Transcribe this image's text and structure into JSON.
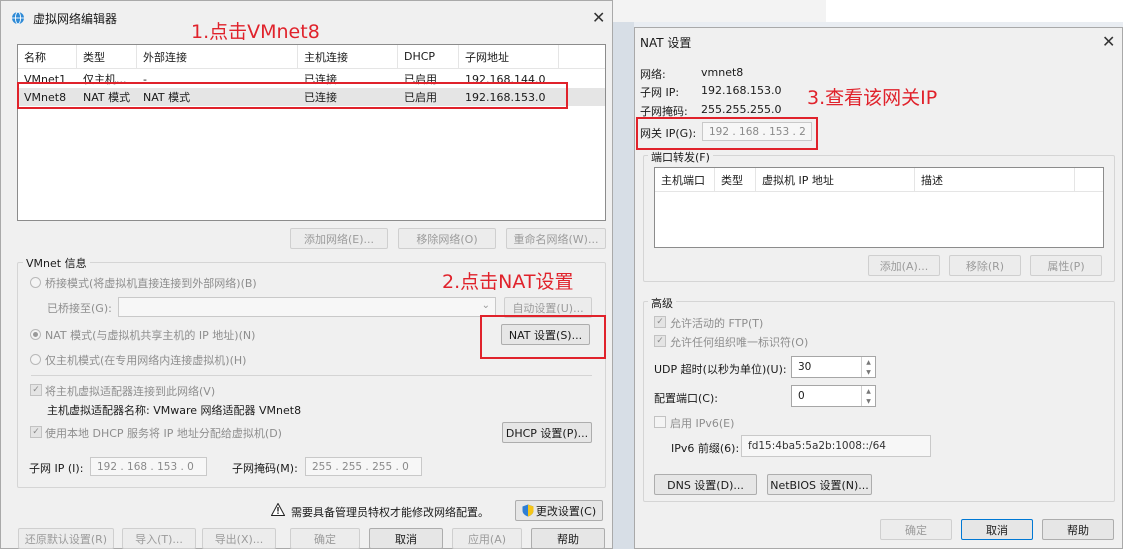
{
  "left_window": {
    "title": "虚拟网络编辑器",
    "columns": [
      "名称",
      "类型",
      "外部连接",
      "主机连接",
      "DHCP",
      "子网地址"
    ],
    "rows": [
      [
        "VMnet1",
        "仅主机...",
        "-",
        "已连接",
        "已启用",
        "192.168.144.0"
      ],
      [
        "VMnet8",
        "NAT 模式",
        "NAT 模式",
        "已连接",
        "已启用",
        "192.168.153.0"
      ]
    ],
    "selected_row": 1,
    "list_buttons": {
      "add": "添加网络(E)...",
      "remove": "移除网络(O)",
      "rename": "重命名网络(W)..."
    },
    "info_title": "VMnet 信息",
    "bridged_label": "桥接模式(将虚拟机直接连接到外部网络)(B)",
    "bridged_to_label": "已桥接至(G):",
    "auto_settings": "自动设置(U)...",
    "nat_label": "NAT 模式(与虚拟机共享主机的 IP 地址)(N)",
    "nat_settings": "NAT 设置(S)...",
    "hostonly_label": "仅主机模式(在专用网络内连接虚拟机)(H)",
    "connect_adapter_label": "将主机虚拟适配器连接到此网络(V)",
    "adapter_name": "主机虚拟适配器名称: VMware 网络适配器 VMnet8",
    "dhcp_label": "使用本地 DHCP 服务将 IP 地址分配给虚拟机(D)",
    "dhcp_settings": "DHCP 设置(P)...",
    "subnet_ip_label": "子网 IP (I):",
    "subnet_ip": "192 . 168 . 153 . 0",
    "subnet_mask_label": "子网掩码(M):",
    "subnet_mask": "255 . 255 . 255 . 0",
    "admin_note": "需要具备管理员特权才能修改网络配置。",
    "change_settings": "更改设置(C)",
    "bottom_buttons": {
      "restore": "还原默认设置(R)",
      "import": "导入(T)...",
      "export": "导出(X)...",
      "ok": "确定",
      "cancel": "取消",
      "apply": "应用(A)",
      "help": "帮助"
    }
  },
  "right_window": {
    "title": "NAT 设置",
    "network_label": "网络:",
    "network_value": "vmnet8",
    "subnet_ip_label": "子网 IP:",
    "subnet_ip_value": "192.168.153.0",
    "subnet_mask_label": "子网掩码:",
    "subnet_mask_value": "255.255.255.0",
    "gateway_label": "网关 IP(G):",
    "gateway_value": "192 . 168 . 153 .  2",
    "port_forward_title": "端口转发(F)",
    "pf_columns": [
      "主机端口",
      "类型",
      "虚拟机 IP 地址",
      "描述"
    ],
    "pf_buttons": {
      "add": "添加(A)...",
      "remove": "移除(R)",
      "props": "属性(P)"
    },
    "advanced_title": "高级",
    "ftp_label": "允许活动的 FTP(T)",
    "oui_label": "允许任何组织唯一标识符(O)",
    "udp_label": "UDP 超时(以秒为单位)(U):",
    "udp_value": "30",
    "config_port_label": "配置端口(C):",
    "config_port_value": "0",
    "ipv6_label": "启用 IPv6(E)",
    "ipv6_prefix_label": "IPv6 前缀(6):",
    "ipv6_prefix_value": "fd15:4ba5:5a2b:1008::/64",
    "dns_settings": "DNS 设置(D)...",
    "netbios_settings": "NetBIOS 设置(N)...",
    "ok": "确定",
    "cancel": "取消",
    "help": "帮助"
  },
  "annotations": {
    "step1": "1.点击VMnet8",
    "step2": "2.点击NAT设置",
    "step3": "3.查看该网关IP"
  },
  "icons": {
    "app": "globe-network-icon",
    "shield": "uac-shield-icon",
    "warning": "warning-icon",
    "close": "close-icon"
  },
  "colors": {
    "annotation": "#e0222b",
    "focus": "#0078d4"
  }
}
